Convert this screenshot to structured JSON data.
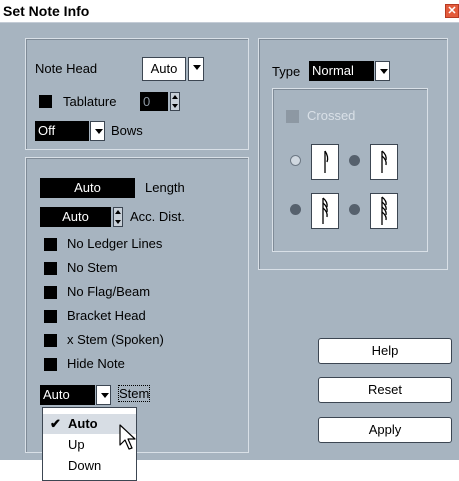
{
  "window": {
    "title": "Set Note Info",
    "close_symbol": "✕"
  },
  "note_head": {
    "label": "Note Head",
    "value": "Auto"
  },
  "tablature": {
    "label": "Tablature",
    "value": "0",
    "checked": true
  },
  "bows": {
    "value": "Off",
    "label": "Bows"
  },
  "length": {
    "value": "Auto",
    "label": "Length"
  },
  "acc_dist": {
    "value": "Auto",
    "label": "Acc. Dist."
  },
  "options": [
    {
      "label": "No Ledger Lines",
      "checked": true
    },
    {
      "label": "No Stem",
      "checked": true
    },
    {
      "label": "No Flag/Beam",
      "checked": true
    },
    {
      "label": "Bracket Head",
      "checked": true
    },
    {
      "label": "x Stem (Spoken)",
      "checked": true
    },
    {
      "label": "Hide Note",
      "checked": true
    }
  ],
  "stem": {
    "value": "Auto",
    "label": "Stem"
  },
  "stem_menu": {
    "items": [
      "Auto",
      "Up",
      "Down"
    ],
    "selected": "Auto",
    "check_symbol": "✔"
  },
  "type": {
    "label": "Type",
    "value": "Normal"
  },
  "crossed": {
    "label": "Crossed",
    "checked": false
  },
  "note_options": [
    {
      "icon": "single-flag-note-icon",
      "selected": true
    },
    {
      "icon": "double-flag-note-icon",
      "selected": false
    },
    {
      "icon": "triple-flag-note-icon",
      "selected": false
    },
    {
      "icon": "quadruple-flag-note-icon",
      "selected": false
    }
  ],
  "buttons": {
    "help": "Help",
    "reset": "Reset",
    "apply": "Apply"
  },
  "colors": {
    "panel": "#a7b4c0",
    "field": "#000000",
    "close": "#e35b3c"
  }
}
